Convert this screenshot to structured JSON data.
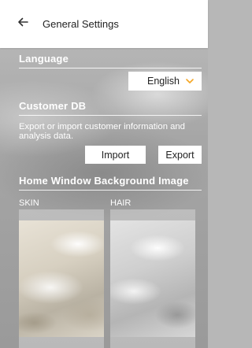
{
  "header": {
    "back_icon": "arrow-left-icon",
    "title": "General Settings"
  },
  "language": {
    "section_title": "Language",
    "selected": "English",
    "dropdown_icon": "chevron-down-icon",
    "accent_color": "#f5a623"
  },
  "customer_db": {
    "section_title": "Customer DB",
    "description": "Export or import customer information and analysis data.",
    "import_label": "Import",
    "export_label": "Export"
  },
  "background_image": {
    "section_title": "Home Window Background Image",
    "items": [
      {
        "label": "SKIN"
      },
      {
        "label": "HAIR"
      }
    ]
  }
}
